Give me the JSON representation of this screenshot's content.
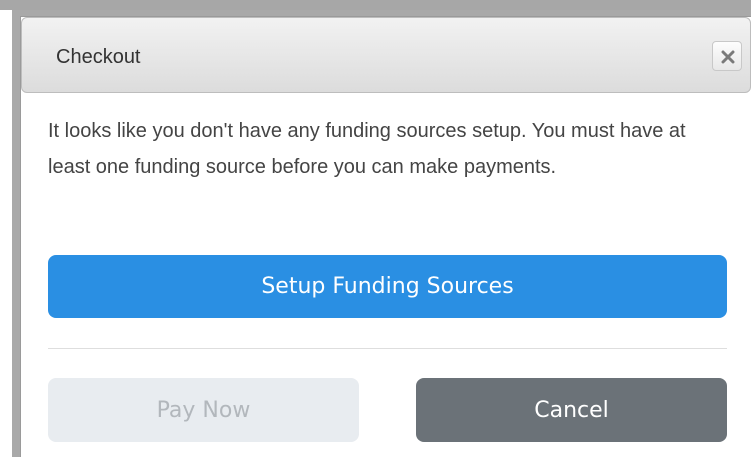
{
  "dialog": {
    "title": "Checkout",
    "close_icon": "close-icon",
    "message": "It looks like you don't have any funding sources setup. You must have at least one funding source before you can make payments.",
    "primary_button_label": "Setup Funding Sources",
    "pay_button_label": "Pay Now",
    "cancel_button_label": "Cancel"
  },
  "colors": {
    "primary": "#2a8fe3",
    "cancel": "#6b7278",
    "disabled": "#e8ecf0"
  }
}
